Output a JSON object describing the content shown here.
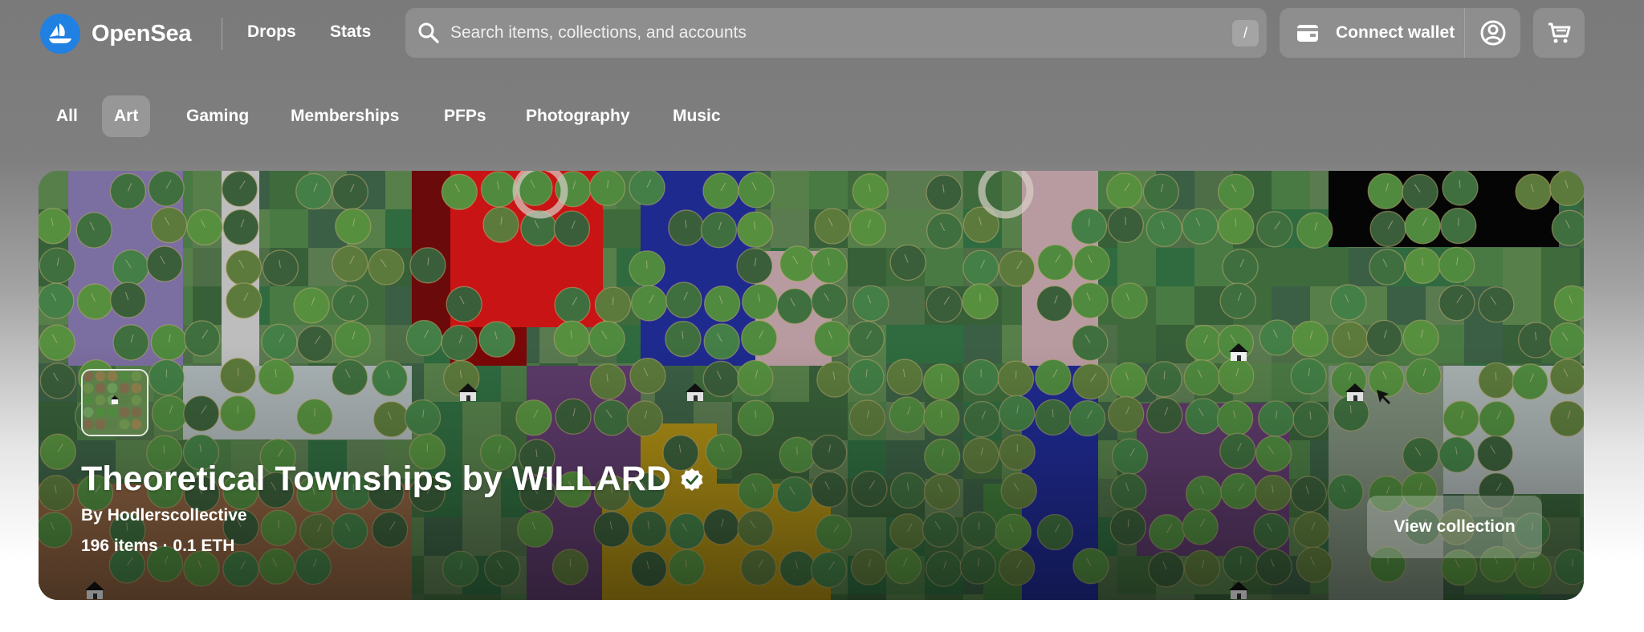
{
  "header": {
    "brand": "OpenSea",
    "nav": [
      "Drops",
      "Stats"
    ],
    "search": {
      "placeholder": "Search items, collections, and accounts",
      "shortcut": "/"
    },
    "connect_wallet": "Connect wallet",
    "icons": {
      "logo": "opensea-logo-icon",
      "search": "search-icon",
      "wallet": "wallet-icon",
      "profile": "profile-icon",
      "cart": "cart-icon"
    }
  },
  "tabs": [
    {
      "label": "All",
      "active": false
    },
    {
      "label": "Art",
      "active": true
    },
    {
      "label": "Gaming",
      "active": false
    },
    {
      "label": "Memberships",
      "active": false
    },
    {
      "label": "PFPs",
      "active": false
    },
    {
      "label": "Photography",
      "active": false
    },
    {
      "label": "Music",
      "active": false
    }
  ],
  "hero": {
    "title": "Theoretical Townships by WILLARD",
    "by_prefix": "By",
    "creator": "Hodlerscollective",
    "stats": "196 items · 0.1 ETH",
    "view_button": "View collection",
    "verified": true
  },
  "colors": {
    "brand_blue": "#2081e2",
    "grass": "#3e6b3e",
    "tree": "#4f8a3f",
    "red": "#c81414",
    "blue": "#1f2a8f",
    "purple": "#5c3a6a",
    "gold": "#a88a14",
    "pink": "#b89ba0",
    "lavender": "#7b6ea0",
    "black": "#050505",
    "brown": "#8a6040"
  }
}
